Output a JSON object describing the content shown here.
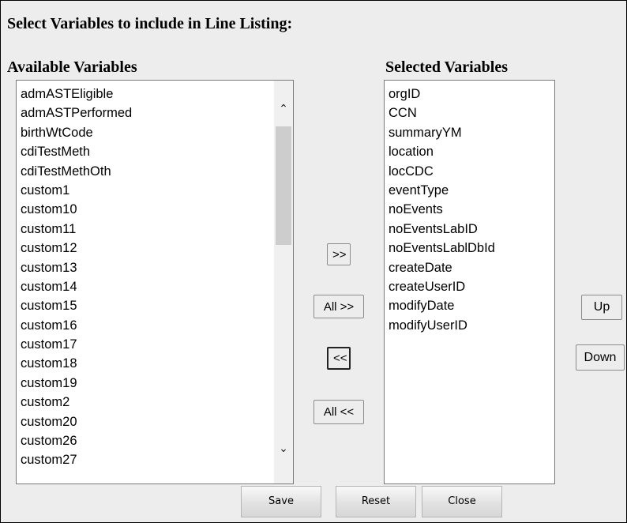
{
  "heading": "Select Variables to include in Line Listing:",
  "available": {
    "title": "Available Variables",
    "items": [
      "admASTEligible",
      "admASTPerformed",
      "birthWtCode",
      "cdiTestMeth",
      "cdiTestMethOth",
      "custom1",
      "custom10",
      "custom11",
      "custom12",
      "custom13",
      "custom14",
      "custom15",
      "custom16",
      "custom17",
      "custom18",
      "custom19",
      "custom2",
      "custom20",
      "custom26",
      "custom27"
    ],
    "scroll_up_icon": "chevron-up-icon",
    "scroll_down_icon": "chevron-down-icon"
  },
  "selected": {
    "title": "Selected Variables",
    "items": [
      "orgID",
      "CCN",
      "summaryYM",
      "location",
      "locCDC",
      "eventType",
      "noEvents",
      "noEventsLabID",
      "noEventsLablDbId",
      "createDate",
      "createUserID",
      "modifyDate",
      "modifyUserID"
    ]
  },
  "transfer": {
    "add_label": ">>",
    "add_all_label": "All >>",
    "remove_label": "<<",
    "remove_all_label": "All <<"
  },
  "order": {
    "up_label": "Up",
    "down_label": "Down"
  },
  "footer": {
    "save_label": "Save",
    "reset_label": "Reset",
    "close_label": "Close"
  }
}
